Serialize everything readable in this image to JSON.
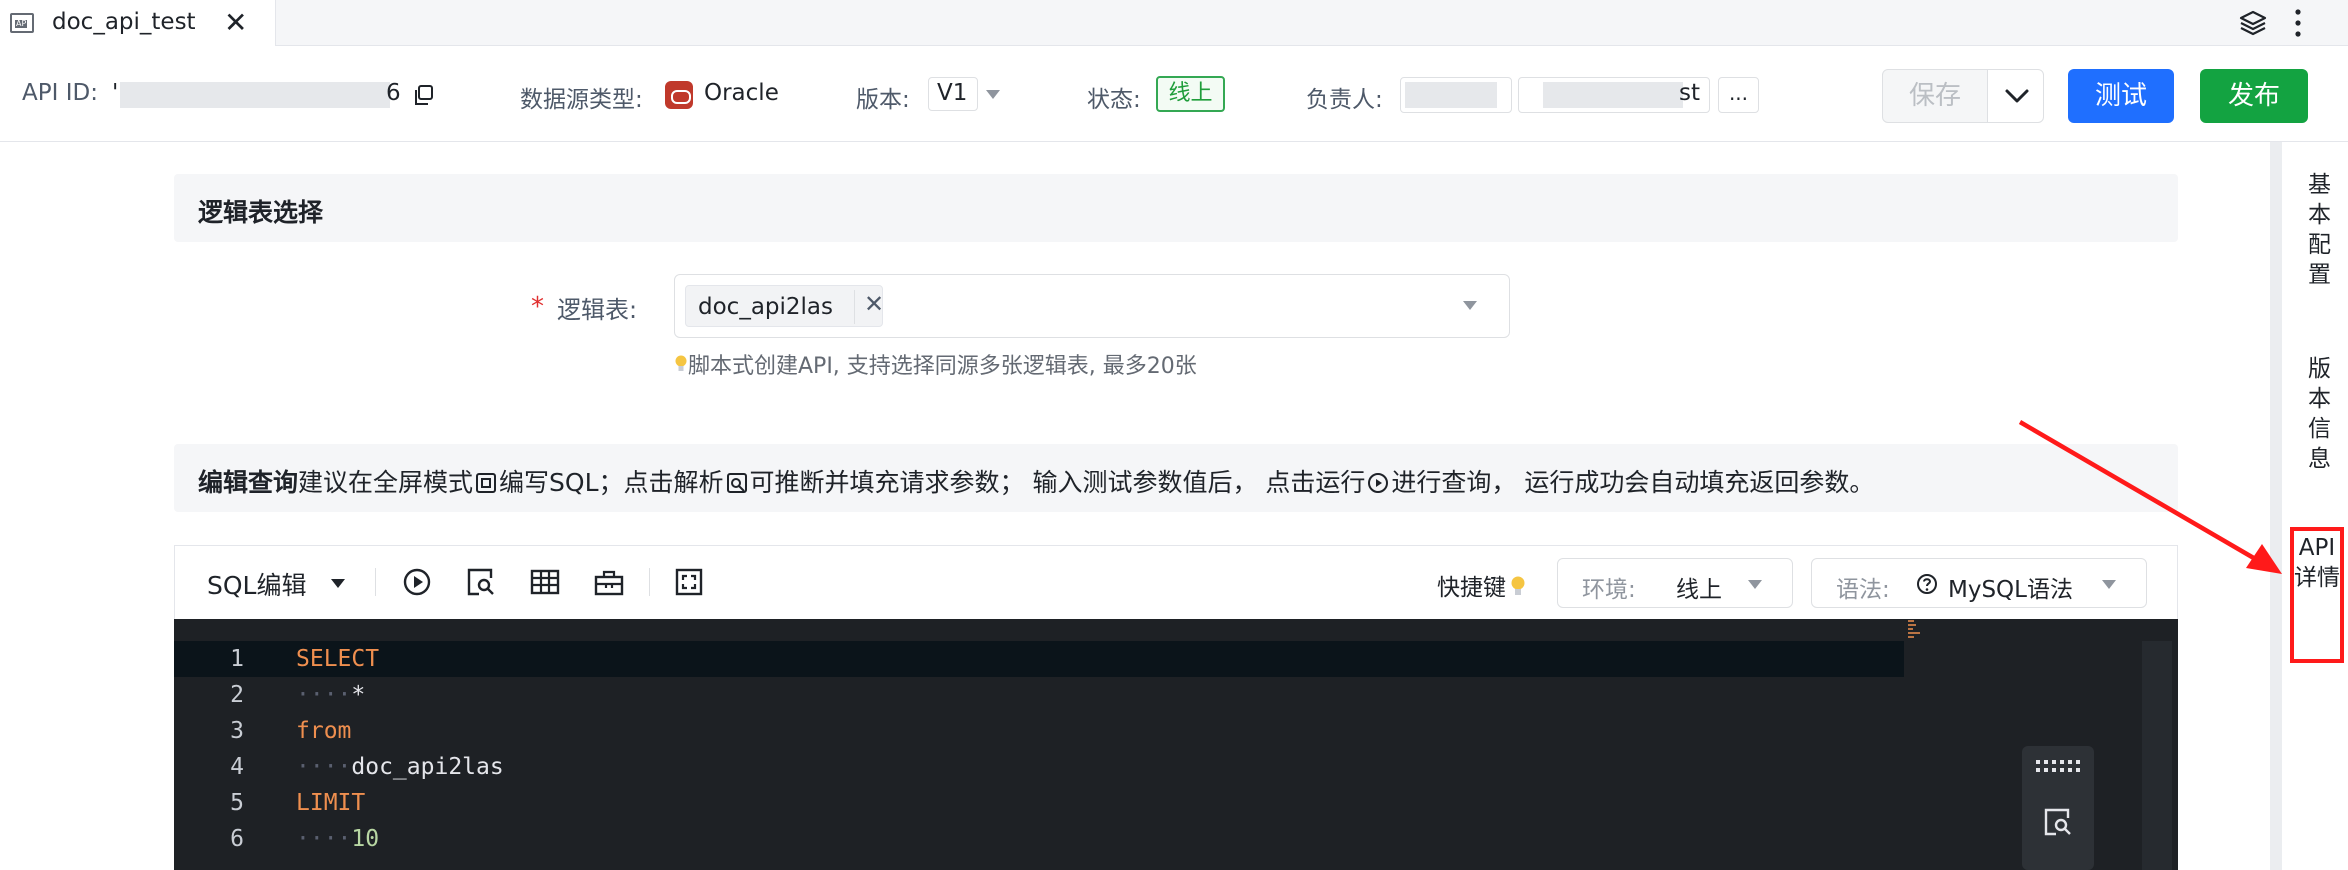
{
  "tab": {
    "title": "doc_api_test",
    "close_glyph": "✕",
    "icon": "api-doc-icon"
  },
  "header": {
    "api_id_label": "API ID:",
    "api_id_prefix": "'",
    "api_id_suffix": "6",
    "datasource_label": "数据源类型:",
    "datasource_value": "Oracle",
    "version_label": "版本:",
    "version_value": "V1",
    "status_label": "状态:",
    "status_value": "线上",
    "owner_label": "负责人:",
    "owner_suffix": "st",
    "owner_more": "...",
    "save_label": "保存",
    "test_label": "测试",
    "publish_label": "发布"
  },
  "logic_section": {
    "title": "逻辑表选择",
    "required_mark": "*",
    "field_label": "逻辑表:",
    "tag": "doc_api2las",
    "tag_close": "✕",
    "hint": "脚本式创建API, 支持选择同源多张逻辑表, 最多20张"
  },
  "edit_section": {
    "title": "编辑查询",
    "desc_1": "建议在全屏模式",
    "desc_2": "编写SQL；点击解析",
    "desc_3": "可推断并填充请求参数； 输入测试参数值后， 点击运行",
    "desc_4": "进行查询， 运行成功会自动填充返回参数。"
  },
  "editor": {
    "mode": "SQL编辑",
    "shortcut": "快捷键",
    "env_label": "环境:",
    "env_value": "线上",
    "lang_label": "语法:",
    "lang_value": "MySQL语法",
    "lines": [
      {
        "n": "1",
        "indent": "",
        "text": "SELECT"
      },
      {
        "n": "2",
        "indent": "····",
        "text": "*"
      },
      {
        "n": "3",
        "indent": "",
        "text": "from"
      },
      {
        "n": "4",
        "indent": "····",
        "text": "doc_api2las"
      },
      {
        "n": "5",
        "indent": "",
        "text": "LIMIT"
      },
      {
        "n": "6",
        "indent": "····",
        "text": "10"
      }
    ]
  },
  "sidebar": {
    "basic_config": "基本配置",
    "version_info": "版本信息",
    "api_detail": "API详情"
  },
  "colors": {
    "primary": "#1f6fff",
    "publish": "#13a341",
    "status_green": "#34a853",
    "highlight_red": "#ff1a1a",
    "keyword": "#ef8f4f"
  }
}
